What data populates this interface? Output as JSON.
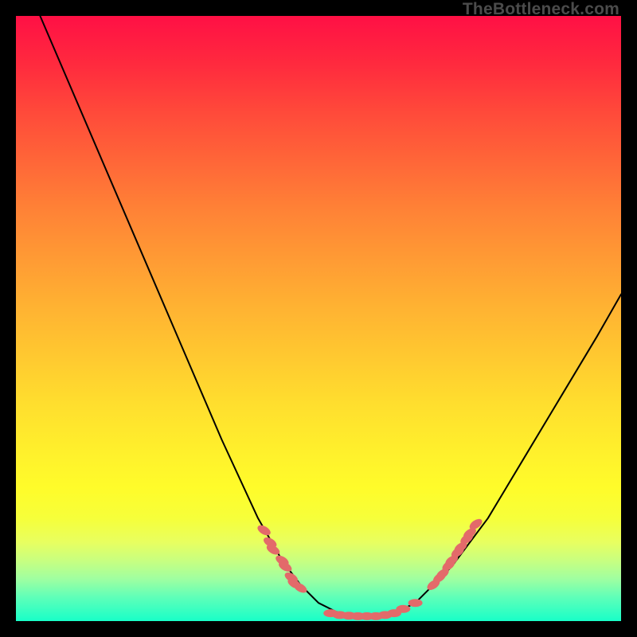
{
  "watermark": "TheBottleneck.com",
  "chart_data": {
    "type": "line",
    "title": "",
    "xlabel": "",
    "ylabel": "",
    "xlim": [
      0,
      1
    ],
    "ylim": [
      0,
      1
    ],
    "legend": false,
    "grid": false,
    "series": [
      {
        "name": "curve",
        "x": [
          0.04,
          0.1,
          0.16,
          0.22,
          0.28,
          0.34,
          0.4,
          0.44,
          0.47,
          0.5,
          0.53,
          0.56,
          0.6,
          0.62,
          0.66,
          0.72,
          0.78,
          0.84,
          0.9,
          0.96,
          1.0
        ],
        "y": [
          1.0,
          0.86,
          0.72,
          0.58,
          0.44,
          0.3,
          0.17,
          0.1,
          0.06,
          0.03,
          0.015,
          0.01,
          0.008,
          0.01,
          0.03,
          0.09,
          0.17,
          0.27,
          0.37,
          0.47,
          0.54
        ]
      }
    ],
    "markers_left": {
      "x": [
        0.41,
        0.42,
        0.425,
        0.44,
        0.445,
        0.455,
        0.46,
        0.47
      ],
      "y": [
        0.15,
        0.13,
        0.118,
        0.1,
        0.09,
        0.072,
        0.062,
        0.055
      ]
    },
    "markers_bottom": {
      "x": [
        0.52,
        0.535,
        0.55,
        0.565,
        0.58,
        0.595,
        0.61,
        0.625,
        0.64,
        0.66
      ],
      "y": [
        0.013,
        0.01,
        0.009,
        0.008,
        0.008,
        0.008,
        0.01,
        0.013,
        0.02,
        0.03
      ]
    },
    "markers_right": {
      "x": [
        0.69,
        0.7,
        0.705,
        0.715,
        0.72,
        0.73,
        0.735,
        0.745,
        0.75,
        0.76
      ],
      "y": [
        0.06,
        0.072,
        0.078,
        0.092,
        0.1,
        0.114,
        0.122,
        0.136,
        0.145,
        0.16
      ]
    },
    "colors": {
      "curve": "#000000",
      "markers": "#e36a6a",
      "frame": "#000000"
    }
  }
}
